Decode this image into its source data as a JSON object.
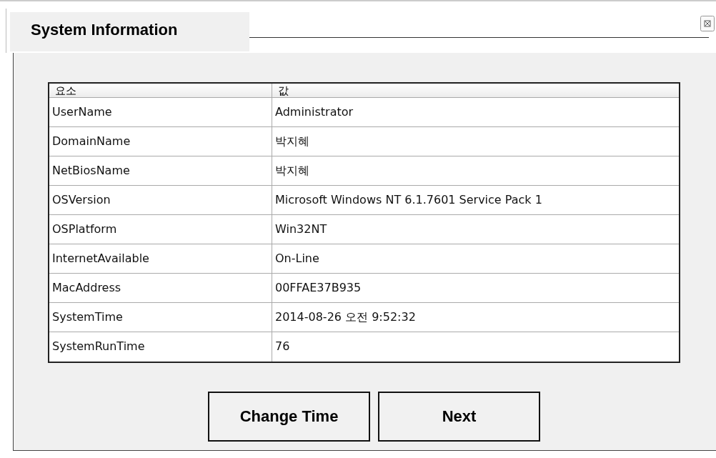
{
  "window": {
    "title": "System Information"
  },
  "table": {
    "columns": [
      "요소",
      "값"
    ],
    "rows": [
      [
        "UserName",
        "Administrator"
      ],
      [
        "DomainName",
        "박지혜"
      ],
      [
        "NetBiosName",
        "박지혜"
      ],
      [
        "OSVersion",
        "Microsoft Windows NT 6.1.7601 Service Pack 1"
      ],
      [
        "OSPlatform",
        "Win32NT"
      ],
      [
        "InternetAvailable",
        "On-Line"
      ],
      [
        "MacAddress",
        "00FFAE37B935"
      ],
      [
        "SystemTime",
        "2014-08-26 오전 9:52:32"
      ],
      [
        "SystemRunTime",
        "76"
      ]
    ]
  },
  "buttons": [
    "Change Time",
    "Next"
  ]
}
